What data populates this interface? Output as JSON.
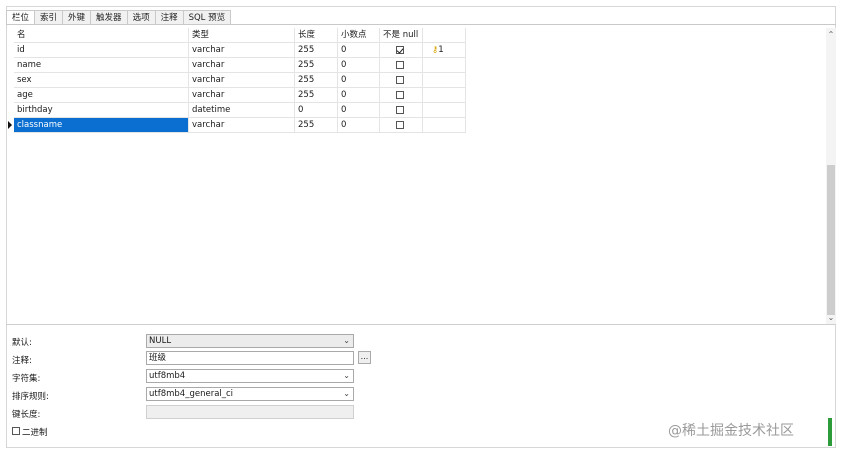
{
  "tabs": [
    "栏位",
    "索引",
    "外键",
    "触发器",
    "选项",
    "注释",
    "SQL 预览"
  ],
  "columns": [
    "名",
    "类型",
    "长度",
    "小数点",
    "不是 null",
    ""
  ],
  "rows": [
    {
      "name": "id",
      "type": "varchar",
      "length": "255",
      "decimals": "0",
      "not_null": true,
      "key": "1"
    },
    {
      "name": "name",
      "type": "varchar",
      "length": "255",
      "decimals": "0",
      "not_null": false,
      "key": ""
    },
    {
      "name": "sex",
      "type": "varchar",
      "length": "255",
      "decimals": "0",
      "not_null": false,
      "key": ""
    },
    {
      "name": "age",
      "type": "varchar",
      "length": "255",
      "decimals": "0",
      "not_null": false,
      "key": ""
    },
    {
      "name": "birthday",
      "type": "datetime",
      "length": "0",
      "decimals": "0",
      "not_null": false,
      "key": ""
    },
    {
      "name": "classname",
      "type": "varchar",
      "length": "255",
      "decimals": "0",
      "not_null": false,
      "key": "",
      "selected": true
    }
  ],
  "props": {
    "default_label": "默认:",
    "default_value": "NULL",
    "comment_label": "注释:",
    "comment_value": "班级",
    "comment_button": "...",
    "charset_label": "字符集:",
    "charset_value": "utf8mb4",
    "collation_label": "排序规则:",
    "collation_value": "utf8mb4_general_ci",
    "keylength_label": "键长度:",
    "binary_label": "二进制"
  },
  "watermark": "@稀土掘金技术社区",
  "icons": {
    "key": "key-icon",
    "dropdown": "chevron-down-icon",
    "row_marker": "current-row-marker-icon"
  },
  "colors": {
    "selection": "#0a6fd1",
    "key": "#d9a400",
    "accent_bar": "#2e9b3a"
  }
}
